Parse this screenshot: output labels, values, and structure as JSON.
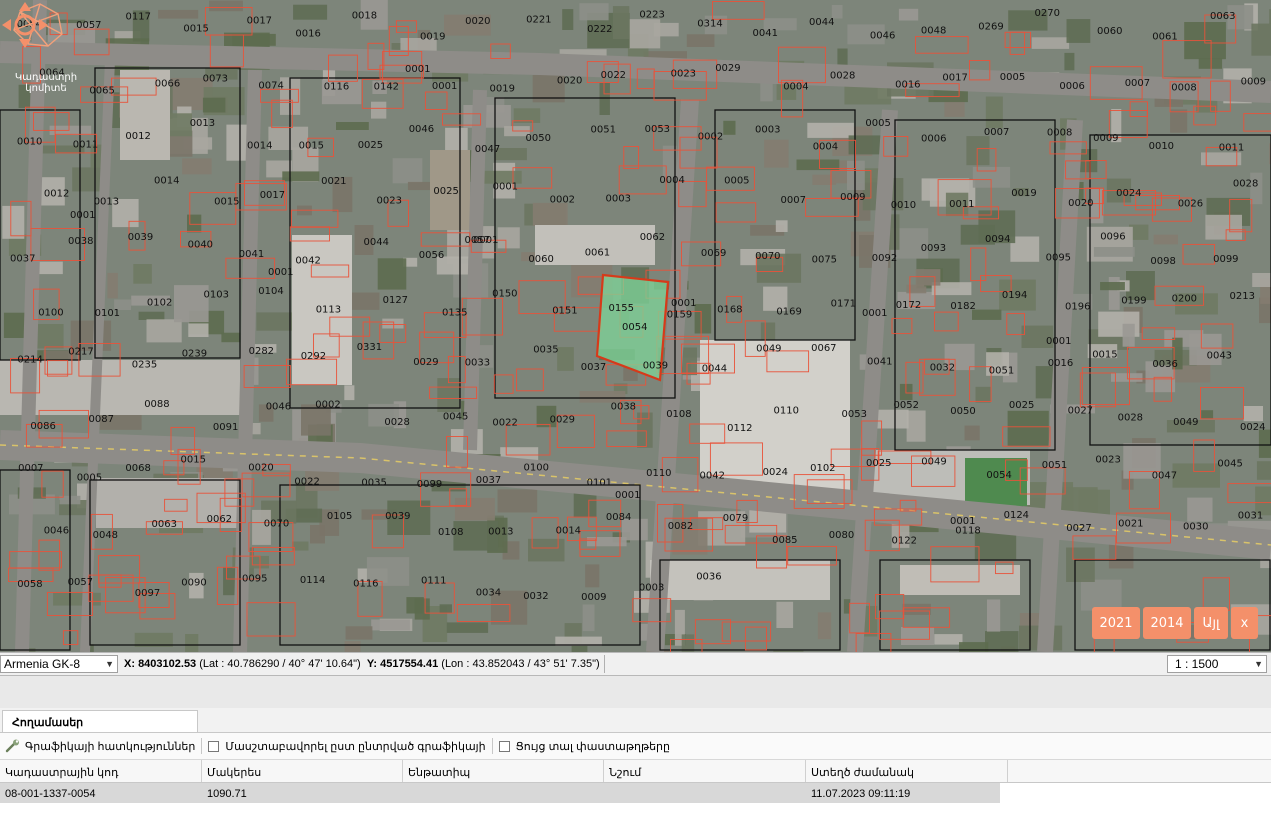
{
  "map": {
    "parcel_labels": [
      "0054",
      "0057",
      "0117",
      "0015",
      "0017",
      "0016",
      "0018",
      "0019",
      "0020",
      "0221",
      "0222",
      "0223",
      "0314",
      "0041",
      "0044",
      "0046",
      "0048",
      "0269",
      "0270",
      "0060",
      "0061",
      "0063",
      "0064",
      "0065",
      "0066",
      "0073",
      "0074",
      "0116",
      "0142",
      "0001",
      "0019",
      "0020",
      "0022",
      "0023",
      "0029",
      "0004",
      "0028",
      "0016",
      "0017",
      "0005",
      "0006",
      "0007",
      "0008",
      "0009",
      "0010",
      "0011",
      "0012",
      "0013",
      "0014",
      "0015",
      "0025",
      "0046",
      "0047",
      "0050",
      "0051",
      "0053",
      "0002",
      "0003",
      "0004",
      "0005",
      "0006",
      "0007",
      "0008",
      "0009",
      "0010",
      "0011",
      "0012",
      "0013",
      "0014",
      "0015",
      "0017",
      "0021",
      "0023",
      "0025",
      "0001",
      "0002",
      "0003",
      "0004",
      "0005",
      "0007",
      "0009",
      "0010",
      "0011",
      "0019",
      "0020",
      "0024",
      "0026",
      "0028",
      "0037",
      "0038",
      "0039",
      "0040",
      "0041",
      "0042",
      "0044",
      "0056",
      "0057",
      "0060",
      "0061",
      "0062",
      "0069",
      "0070",
      "0075",
      "0092",
      "0093",
      "0094",
      "0095",
      "0096",
      "0098",
      "0099",
      "0100",
      "0101",
      "0102",
      "0103",
      "0104",
      "0113",
      "0127",
      "0135",
      "0150",
      "0151",
      "0155",
      "0159",
      "0168",
      "0169",
      "0171",
      "0172",
      "0182",
      "0194",
      "0196",
      "0199",
      "0200",
      "0213",
      "0214",
      "0217",
      "0235",
      "0239",
      "0282",
      "0292",
      "0331",
      "0029",
      "0033",
      "0035",
      "0037",
      "0039",
      "0044",
      "0049",
      "0067",
      "0041",
      "0032",
      "0051",
      "0016",
      "0015",
      "0036",
      "0043",
      "0086",
      "0087",
      "0088",
      "0091",
      "0046",
      "0002",
      "0028",
      "0045",
      "0022",
      "0029",
      "0038",
      "0108",
      "0112",
      "0110",
      "0053",
      "0052",
      "0050",
      "0025",
      "0027",
      "0028",
      "0049",
      "0024",
      "0007",
      "0005",
      "0068",
      "0015",
      "0020",
      "0022",
      "0035",
      "0099",
      "0037",
      "0100",
      "0101",
      "0110",
      "0042",
      "0024",
      "0102",
      "0025",
      "0049",
      "0054",
      "0051",
      "0023",
      "0047",
      "0045",
      "0046",
      "0048",
      "0063",
      "0062",
      "0070",
      "0105",
      "0039",
      "0108",
      "0013",
      "0014",
      "0084",
      "0082",
      "0079",
      "0085",
      "0080",
      "0122",
      "0118",
      "0124",
      "0027",
      "0021",
      "0030",
      "0031",
      "0058",
      "0057",
      "0097",
      "0090",
      "0095",
      "0114",
      "0116",
      "0111",
      "0034",
      "0032",
      "0009",
      "0003",
      "0036"
    ],
    "road_label": "0001",
    "selected_parcel_label": "0054",
    "logo_text": "Կադաստրի կոմիտե",
    "pan_icon": "pan-arrows-icon",
    "history_buttons": [
      {
        "label": "2021"
      },
      {
        "label": "2014"
      },
      {
        "label": "Այլ"
      },
      {
        "label": "x"
      }
    ],
    "colors": {
      "parcel_outline": "#e8533a",
      "selected_fill": "#7fd69a",
      "selected_outline": "#d63a1a",
      "button_bg": "#f4906a"
    }
  },
  "status": {
    "projection": "Armenia GK-8",
    "x_label": "X:",
    "x_value": "8403102.53",
    "lat_text": "(Lat : 40.786290 / 40° 47' 10.64\")",
    "y_label": "Y:",
    "y_value": "4517554.41",
    "lon_text": "(Lon : 43.852043 / 43° 51' 7.35\")",
    "scale": "1 : 1500"
  },
  "panel": {
    "tab_label": "Հողամասեր",
    "toolbar": {
      "graphic_props": "Գրաֆիկայի հատկություններ",
      "zoom_by_selected": "Մասշտաբավորել ըստ ընտրված գրաֆիկայի",
      "show_docs": "Ցույց տալ փաստաթղթերը",
      "wrench_icon": "wrench-icon"
    },
    "columns": [
      "Կադաստրային կոդ",
      "Մակերես",
      "Ենթատիպ",
      "Նշում",
      "Ստեղծ ժամանակ"
    ],
    "rows": [
      {
        "code": "08-001-1337-0054",
        "area": "1090.71",
        "subtype": "",
        "note": "",
        "created": "11.07.2023 09:11:19"
      }
    ]
  }
}
